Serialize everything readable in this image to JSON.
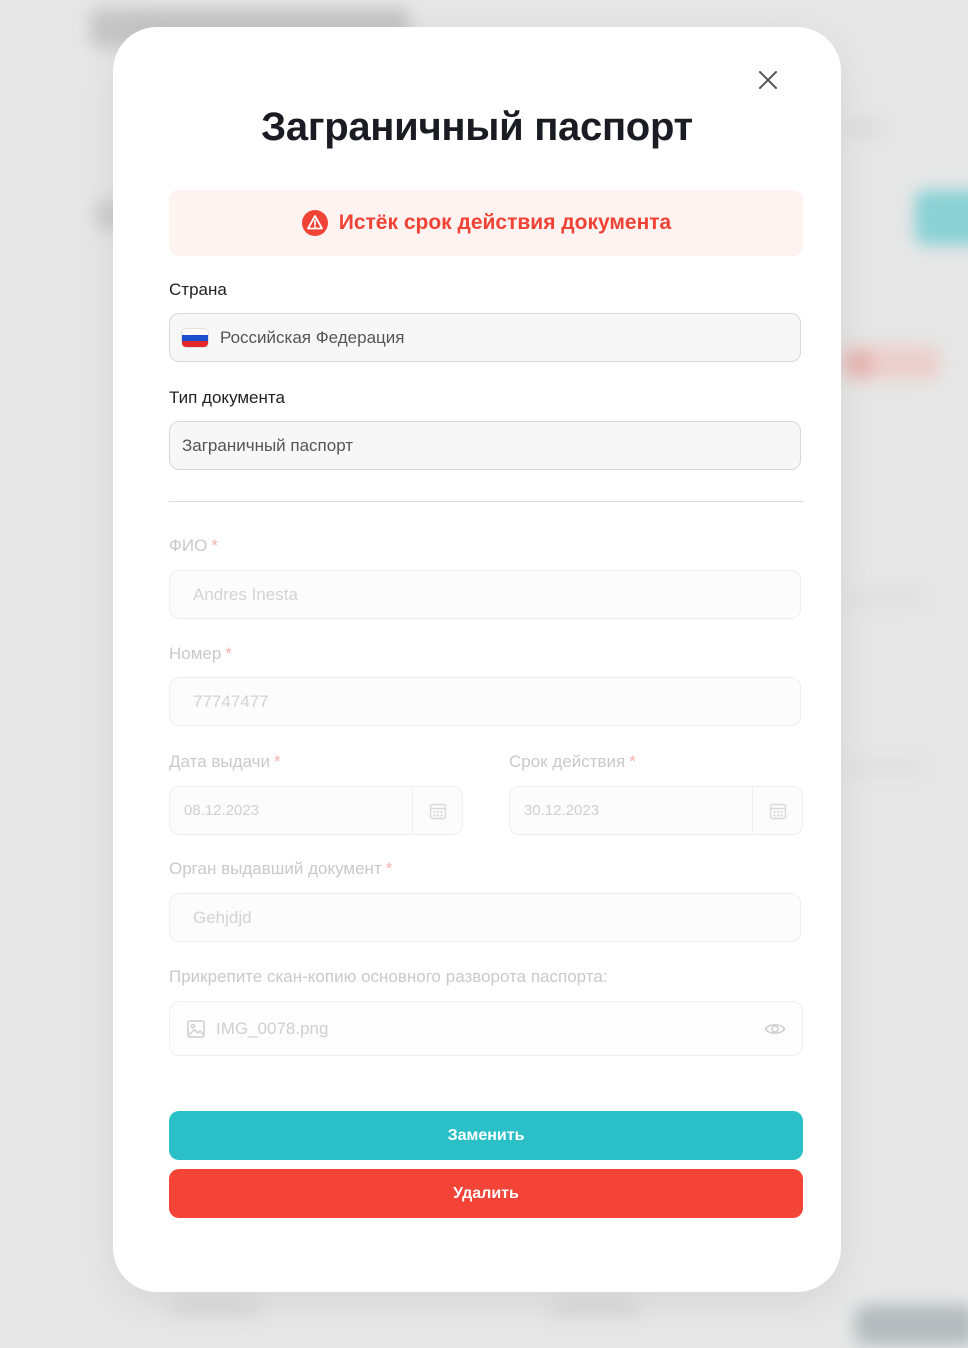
{
  "modal": {
    "title": "Заграничный паспорт",
    "alert": "Истёк срок действия документа"
  },
  "form": {
    "country": {
      "label": "Страна",
      "value": "Российская Федерация"
    },
    "doc_type": {
      "label": "Тип документа",
      "value": "Заграничный паспорт"
    },
    "fio": {
      "label": "ФИО",
      "required": "*",
      "value": "Andres Inesta"
    },
    "number": {
      "label": "Номер",
      "required": "*",
      "value": "77747477"
    },
    "issue_date": {
      "label": "Дата выдачи",
      "required": "*",
      "value": "08.12.2023"
    },
    "expiry_date": {
      "label": "Срок действия",
      "required": "*",
      "value": "30.12.2023"
    },
    "authority": {
      "label": "Орган выдавший документ",
      "required": "*",
      "value": "Gehjdjd"
    },
    "scan": {
      "label": "Прикрепите скан-копию основного разворота паспорта:",
      "file": "IMG_0078.png"
    }
  },
  "buttons": {
    "replace": "Заменить",
    "delete": "Удалить"
  },
  "colors": {
    "accent": "#2bc0c8",
    "danger": "#f44337",
    "alert_bg": "#fff3f1",
    "alert_text": "#f04335"
  },
  "icons": [
    "close-icon",
    "warning-icon",
    "russia-flag-icon",
    "calendar-icon",
    "image-icon",
    "eye-icon"
  ]
}
